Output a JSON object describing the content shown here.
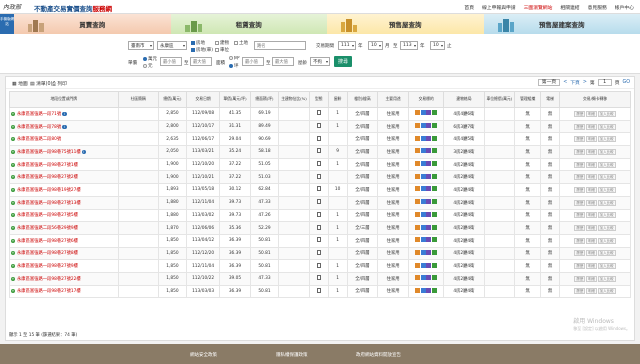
{
  "header": {
    "logo": "內政部",
    "title_blue": "不動產交易實價查詢",
    "title_red": "服務網",
    "links": [
      "首頁",
      "線上申報與申請",
      "三圖瀏覽網站",
      "相關連結",
      "意見服務",
      "帳戶中心"
    ],
    "side_badge": "手機版網站"
  },
  "tabs": [
    "買賣查詢",
    "租賃查詢",
    "預售屋查詢",
    "預售屋建案查詢"
  ],
  "filters": {
    "city": "臺南市",
    "district": "永康區",
    "chk_land": "房地",
    "chk_parking": "房地(車)",
    "chk_land_only": "土地",
    "chk_building": "建物",
    "chk_parking2": "車位",
    "road_placeholder": "路名",
    "date_label": "交易期間",
    "y1": "111",
    "m1": "10",
    "y2": "113",
    "m2": "10",
    "unit_label": "單價",
    "unit1": "萬元",
    "unit2": "元",
    "min_ph": "最小值",
    "max_ph": "最大值",
    "area_label": "面積",
    "area_unit1": "M²",
    "area_unit2": "坪",
    "age_label": "屋齡",
    "age_value": "不拘",
    "search": "搜尋",
    "year_suffix": "年",
    "month_suffix": "月",
    "to": "至",
    "range_to": "至",
    "area_to": "至",
    "later": "止"
  },
  "panel": {
    "map_label": "地圖",
    "list_label": "清單(0)",
    "print_label": "列印",
    "pager_first": "第一頁",
    "pager_prev": "<",
    "pager_next": "下頁",
    "pager_last": ">",
    "pager_label": "第",
    "pager_page": "1",
    "pager_of": "頁",
    "go": "GO",
    "footer_note": "顯示 1 至 15 筆 (篩選結果：74 筆)"
  },
  "table": {
    "headers": [
      "地段位置或門牌",
      "社區簡稱",
      "總價(萬元)",
      "交易日期",
      "單價(萬元/坪)",
      "總面積(坪)",
      "主建物佔比(%)",
      "型態",
      "屋齡",
      "樓別/樓高",
      "主要用途",
      "交易標的",
      "建物格局",
      "車位總價(萬元)",
      "管理組織",
      "電梯",
      "交易/擷卡轉移"
    ],
    "rows": [
      {
        "addr": "永康區富強路一段71號",
        "info": true,
        "price": "2,850",
        "date": "112/09/08",
        "unit": "41.35",
        "area": "69.19",
        "ratio": "",
        "age": "1",
        "floor": "全/四層",
        "use": "住家用",
        "layout": "4房4廳6衛",
        "mgmt": "無",
        "elev": "無"
      },
      {
        "addr": "永康區富強路一段78號",
        "info": true,
        "price": "2,800",
        "date": "112/10/17",
        "unit": "31.31",
        "area": "89.49",
        "ratio": "",
        "age": "1",
        "floor": "全/四層",
        "use": "住家用",
        "layout": "6房3廳7衛",
        "mgmt": "無",
        "elev": "無"
      },
      {
        "addr": "永康區富強路二段80號",
        "info": false,
        "price": "2,635",
        "date": "112/06/17",
        "unit": "29.04",
        "area": "90.69",
        "ratio": "",
        "age": "",
        "floor": "全/四層",
        "use": "住家用",
        "layout": "4房4廳5衛",
        "mgmt": "無",
        "elev": "無"
      },
      {
        "addr": "永康區富強路一段98巷75號11樓",
        "info": true,
        "price": "2,050",
        "date": "113/03/21",
        "unit": "35.24",
        "area": "58.18",
        "ratio": "",
        "age": "9",
        "floor": "全/四層",
        "use": "住家用",
        "layout": "3房2廳4衛",
        "mgmt": "無",
        "elev": "無"
      },
      {
        "addr": "永康區富強路一段98巷27號1樓",
        "info": false,
        "price": "1,900",
        "date": "112/10/20",
        "unit": "37.22",
        "area": "51.05",
        "ratio": "",
        "age": "1",
        "floor": "全/四層",
        "use": "住家用",
        "layout": "4房2廳4衛",
        "mgmt": "無",
        "elev": "無"
      },
      {
        "addr": "永康區富強路一段98巷27號2樓",
        "info": false,
        "price": "1,900",
        "date": "112/10/21",
        "unit": "37.22",
        "area": "51.03",
        "ratio": "",
        "age": "",
        "floor": "全/四層",
        "use": "住家用",
        "layout": "4房2廳4衛",
        "mgmt": "無",
        "elev": "無"
      },
      {
        "addr": "永康區富強路一段98巷19號27樓",
        "info": false,
        "price": "1,893",
        "date": "113/05/18",
        "unit": "30.12",
        "area": "62.84",
        "ratio": "",
        "age": "10",
        "floor": "全/四層",
        "use": "住家用",
        "layout": "4房2廳4衛",
        "mgmt": "無",
        "elev": "無"
      },
      {
        "addr": "永康區富強路一段98巷27號13樓",
        "info": false,
        "price": "1,880",
        "date": "112/11/04",
        "unit": "39.73",
        "area": "47.33",
        "ratio": "",
        "age": "",
        "floor": "全/四層",
        "use": "住家用",
        "layout": "4房2廳4衛",
        "mgmt": "無",
        "elev": "無"
      },
      {
        "addr": "永康區富強路一段98巷27號5樓",
        "info": false,
        "price": "1,880",
        "date": "113/03/02",
        "unit": "39.73",
        "area": "47.26",
        "ratio": "",
        "age": "1",
        "floor": "全/四層",
        "use": "住家用",
        "layout": "4房2廳4衛",
        "mgmt": "無",
        "elev": "無"
      },
      {
        "addr": "永康區富強路二段56巷29號9樓",
        "info": false,
        "price": "1,870",
        "date": "112/06/06",
        "unit": "35.36",
        "area": "52.29",
        "ratio": "",
        "age": "1",
        "floor": "全/三層",
        "use": "住家用",
        "layout": "4房2廳4衛",
        "mgmt": "無",
        "elev": "無"
      },
      {
        "addr": "永康區富強路一段98巷27號6樓",
        "info": false,
        "price": "1,850",
        "date": "113/04/12",
        "unit": "36.39",
        "area": "50.81",
        "ratio": "",
        "age": "1",
        "floor": "全/四層",
        "use": "住家用",
        "layout": "4房2廳4衛",
        "mgmt": "無",
        "elev": "無"
      },
      {
        "addr": "永康區富強路一段98巷27號8樓",
        "info": false,
        "price": "1,850",
        "date": "112/12/20",
        "unit": "36.39",
        "area": "50.81",
        "ratio": "",
        "age": "",
        "floor": "全/四層",
        "use": "住家用",
        "layout": "4房2廳4衛",
        "mgmt": "無",
        "elev": "無"
      },
      {
        "addr": "永康區富強路一段98巷27號9樓",
        "info": false,
        "price": "1,850",
        "date": "112/11/04",
        "unit": "36.39",
        "area": "50.81",
        "ratio": "",
        "age": "1",
        "floor": "全/四層",
        "use": "住家用",
        "layout": "4房2廳4衛",
        "mgmt": "無",
        "elev": "無"
      },
      {
        "addr": "永康區富強路一段98巷27號22樓",
        "info": false,
        "price": "1,850",
        "date": "112/10/22",
        "unit": "39.05",
        "area": "47.33",
        "ratio": "",
        "age": "1",
        "floor": "全/四層",
        "use": "住家用",
        "layout": "4房2廳4衛",
        "mgmt": "無",
        "elev": "無"
      },
      {
        "addr": "永康區富強路一段98巷27號17樓",
        "info": false,
        "price": "1,850",
        "date": "113/03/03",
        "unit": "36.39",
        "area": "50.81",
        "ratio": "",
        "age": "1",
        "floor": "全/四層",
        "use": "住家用",
        "layout": "4房2廳4衛",
        "mgmt": "無",
        "elev": "無"
      }
    ],
    "action_labels": [
      "履歷",
      "明細",
      "加入比較"
    ]
  },
  "footer": {
    "links": [
      "網站安全政策",
      "隱私權保護政策",
      "政府網站資料開放宣告"
    ],
    "watermark1": "啟用 Windows",
    "watermark2": "移至 [設定] 以啟用 Windows。"
  },
  "colors": {
    "accent": "#1a8f6a",
    "link_red": "#c00",
    "brand_blue": "#1a4f8b",
    "footer": "#8a7b66"
  }
}
